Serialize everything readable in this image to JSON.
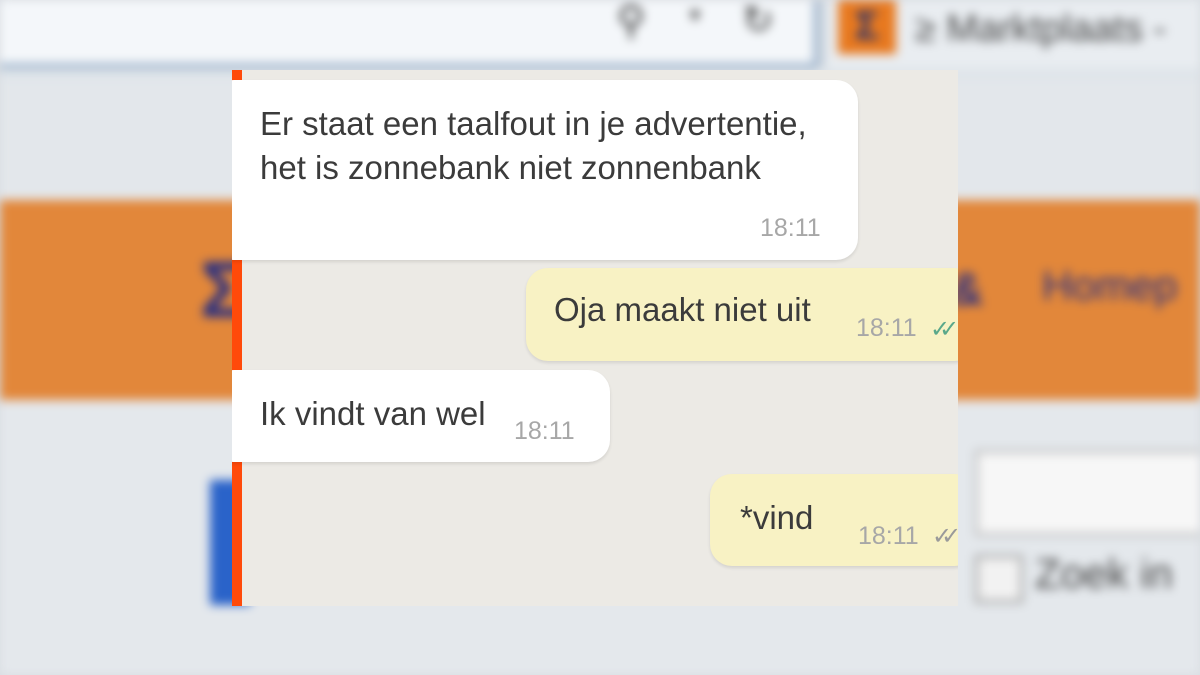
{
  "background": {
    "tab_title": "≥ Marktplaats -",
    "nav_link": "Homep",
    "nav_symbol": "&",
    "checkbox_label": "Zoek in",
    "brand_icon": "marktplaats-logo-icon",
    "colors": {
      "orange_bar": "#e2873a",
      "logo_blue": "#2a3080"
    }
  },
  "chat": {
    "accent_color": "#ff4a0a",
    "messages": [
      {
        "direction": "incoming",
        "lines": [
          "Er staat een taalfout in je advertentie,",
          "het is zonnebank niet zonnenbank"
        ],
        "time": "18:11"
      },
      {
        "direction": "outgoing",
        "lines": [
          "Oja maakt niet uit"
        ],
        "time": "18:11",
        "ticks": "✓✓",
        "tick_status": "read"
      },
      {
        "direction": "incoming",
        "lines": [
          "Ik vindt van wel"
        ],
        "time": "18:11"
      },
      {
        "direction": "outgoing",
        "lines": [
          "*vind"
        ],
        "time": "18:11",
        "ticks": "✓✓",
        "tick_status": "delivered"
      }
    ]
  }
}
